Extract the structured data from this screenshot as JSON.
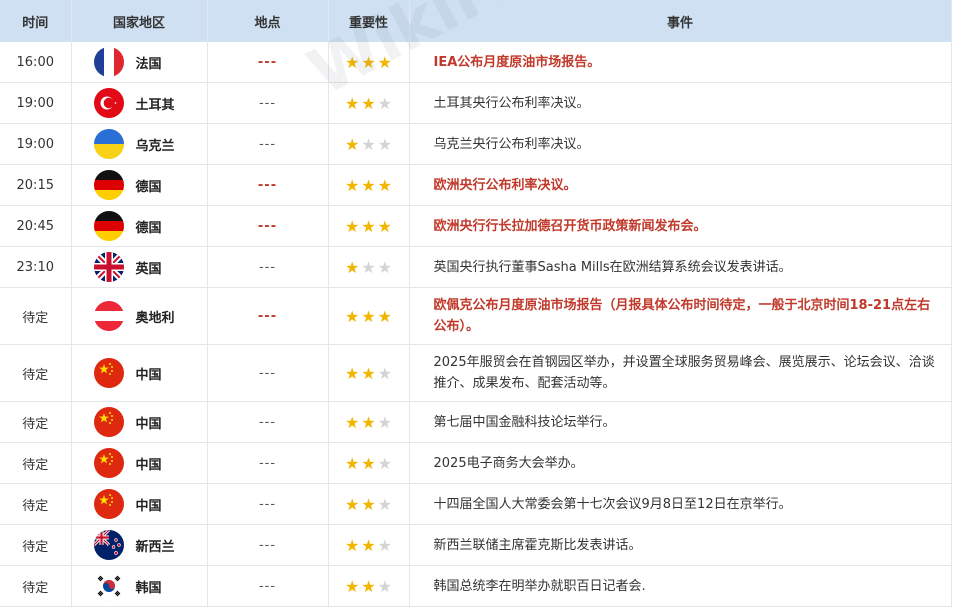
{
  "headers": {
    "time": "时间",
    "country": "国家地区",
    "place": "地点",
    "importance": "重要性",
    "event": "事件"
  },
  "watermark": "WikiFX",
  "colors": {
    "header_bg": "#cfe0f3",
    "highlight": "#c0392b",
    "star_on": "#f2b500",
    "star_off": "#d4d4d4"
  },
  "rows": [
    {
      "time": "16:00",
      "flag": "france-flag",
      "country": "法国",
      "place": "---",
      "stars": 3,
      "highlight": true,
      "event": "IEA公布月度原油市场报告。"
    },
    {
      "time": "19:00",
      "flag": "turkey-flag",
      "country": "土耳其",
      "place": "---",
      "stars": 2,
      "highlight": false,
      "event": "土耳其央行公布利率决议。"
    },
    {
      "time": "19:00",
      "flag": "ukraine-flag",
      "country": "乌克兰",
      "place": "---",
      "stars": 1,
      "highlight": false,
      "event": "乌克兰央行公布利率决议。"
    },
    {
      "time": "20:15",
      "flag": "germany-flag",
      "country": "德国",
      "place": "---",
      "stars": 3,
      "highlight": true,
      "event": "欧洲央行公布利率决议。"
    },
    {
      "time": "20:45",
      "flag": "germany-flag",
      "country": "德国",
      "place": "---",
      "stars": 3,
      "highlight": true,
      "event": "欧洲央行行长拉加德召开货币政策新闻发布会。"
    },
    {
      "time": "23:10",
      "flag": "uk-flag",
      "country": "英国",
      "place": "---",
      "stars": 1,
      "highlight": false,
      "event": "英国央行执行董事Sasha Mills在欧洲结算系统会议发表讲话。"
    },
    {
      "time": "待定",
      "flag": "austria-flag",
      "country": "奥地利",
      "place": "---",
      "stars": 3,
      "highlight": true,
      "event": "欧佩克公布月度原油市场报告（月报具体公布时间待定，一般于北京时间18-21点左右公布）。"
    },
    {
      "time": "待定",
      "flag": "china-flag",
      "country": "中国",
      "place": "---",
      "stars": 2,
      "highlight": false,
      "event": "2025年服贸会在首钢园区举办，并设置全球服务贸易峰会、展览展示、论坛会议、洽谈推介、成果发布、配套活动等。"
    },
    {
      "time": "待定",
      "flag": "china-flag",
      "country": "中国",
      "place": "---",
      "stars": 2,
      "highlight": false,
      "event": "第七届中国金融科技论坛举行。"
    },
    {
      "time": "待定",
      "flag": "china-flag",
      "country": "中国",
      "place": "---",
      "stars": 2,
      "highlight": false,
      "event": "2025电子商务大会举办。"
    },
    {
      "time": "待定",
      "flag": "china-flag",
      "country": "中国",
      "place": "---",
      "stars": 2,
      "highlight": false,
      "event": "十四届全国人大常委会第十七次会议9月8日至12日在京举行。"
    },
    {
      "time": "待定",
      "flag": "nz-flag",
      "country": "新西兰",
      "place": "---",
      "stars": 2,
      "highlight": false,
      "event": "新西兰联储主席霍克斯比发表讲话。"
    },
    {
      "time": "待定",
      "flag": "korea-flag",
      "country": "韩国",
      "place": "---",
      "stars": 2,
      "highlight": false,
      "event": "韩国总统李在明举办就职百日记者会."
    }
  ]
}
